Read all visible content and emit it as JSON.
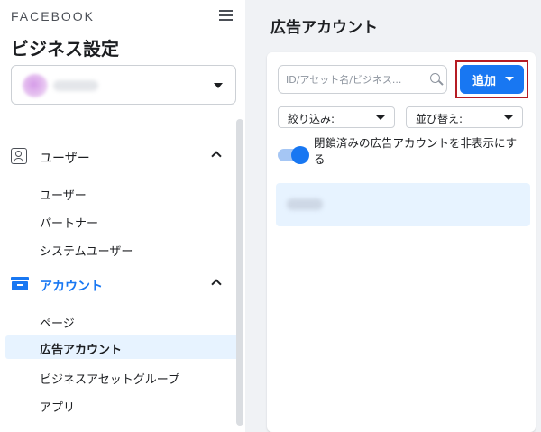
{
  "sidebar": {
    "brand": "FACEBOOK",
    "title": "ビジネス設定",
    "sections": [
      {
        "label": "ユーザー",
        "icon": "user-box-icon",
        "items": [
          {
            "label": "ユーザー"
          },
          {
            "label": "パートナー"
          },
          {
            "label": "システムユーザー"
          }
        ]
      },
      {
        "label": "アカウント",
        "icon": "briefcase-icon",
        "items": [
          {
            "label": "ページ"
          },
          {
            "label": "広告アカウント",
            "active": true
          },
          {
            "label": "ビジネスアセットグループ"
          },
          {
            "label": "アプリ"
          }
        ]
      }
    ]
  },
  "main": {
    "title": "広告アカウント",
    "search": {
      "placeholder": "ID/アセット名/ビジネス..."
    },
    "add_button": {
      "label": "追加"
    },
    "filter": {
      "label": "絞り込み:"
    },
    "sort": {
      "label": "並び替え:"
    },
    "toggle": {
      "label": "閉鎖済みの広告アカウントを非表示にする",
      "on": true
    }
  },
  "colors": {
    "accent": "#1877f2",
    "highlight_box": "#b51c24",
    "active_row": "#e7f3ff",
    "panel_bg": "#f0f2f5"
  }
}
